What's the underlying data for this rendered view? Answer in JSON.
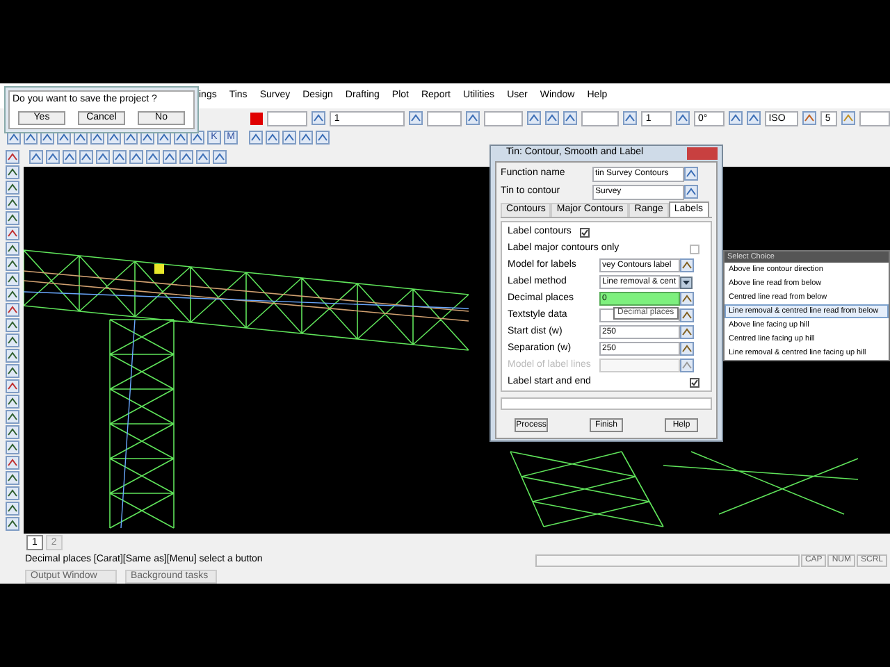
{
  "save_dialog": {
    "message": "Do you want to save the project ?",
    "buttons": [
      "Yes",
      "Cancel",
      "No"
    ]
  },
  "menu_bar": [
    "ings",
    "Tins",
    "Survey",
    "Design",
    "Drafting",
    "Plot",
    "Report",
    "Utilities",
    "User",
    "Window",
    "Help"
  ],
  "toolbar_fields": [
    {
      "value": "1"
    },
    {
      "value": "1"
    },
    {
      "value": "0°"
    },
    {
      "value": "ISO"
    },
    {
      "value": "5"
    }
  ],
  "toolbar_letters": [
    "K",
    "M"
  ],
  "tin_dialog": {
    "title": "Tin: Contour, Smooth and Label",
    "function_name": {
      "label": "Function name",
      "value": "tin Survey Contours"
    },
    "tin_to_contour": {
      "label": "Tin to contour",
      "value": "Survey"
    },
    "tabs": [
      {
        "label": "Contours",
        "selected": false
      },
      {
        "label": "Major Contours",
        "selected": false
      },
      {
        "label": "Range",
        "selected": false
      },
      {
        "label": "Labels",
        "selected": true
      }
    ],
    "rows": [
      {
        "kind": "checkbox_inline",
        "label": "Label contours",
        "checked": true
      },
      {
        "kind": "checkbox",
        "label": "Label major contours only",
        "checked": false
      },
      {
        "kind": "field",
        "label": "Model for labels",
        "value": "vey Contours label",
        "disabled": false,
        "active": false
      },
      {
        "kind": "dropdown",
        "label": "Label method",
        "value": "Line removal & cent"
      },
      {
        "kind": "field",
        "label": "Decimal places",
        "value": "0",
        "disabled": false,
        "active": true
      },
      {
        "kind": "field",
        "label": "Textstyle data",
        "value": "",
        "disabled": false,
        "active": false
      },
      {
        "kind": "field",
        "label": "Start dist (w)",
        "value": "250",
        "disabled": false,
        "active": false
      },
      {
        "kind": "field",
        "label": "Separation (w)",
        "value": "250",
        "disabled": false,
        "active": false
      },
      {
        "kind": "field",
        "label": "Model of label lines",
        "value": "",
        "disabled": true,
        "active": false
      },
      {
        "kind": "checkbox",
        "label": "Label start and end",
        "checked": true
      }
    ],
    "tooltip": "Decimal places",
    "buttons": [
      "Process",
      "Finish",
      "Help"
    ]
  },
  "select_choice": {
    "title": "Select Choice",
    "options": [
      {
        "label": "Above line contour direction",
        "selected": false
      },
      {
        "label": "Above line read from below",
        "selected": false
      },
      {
        "label": "Centred line read from below",
        "selected": false
      },
      {
        "label": "Line removal & centred line read from below",
        "selected": true
      },
      {
        "label": "Above line facing up hill",
        "selected": false
      },
      {
        "label": "Centred line facing up hill",
        "selected": false
      },
      {
        "label": "Line removal & centred line facing up hill",
        "selected": false
      }
    ]
  },
  "view_tabs": [
    {
      "label": "1",
      "selected": true
    },
    {
      "label": "2",
      "selected": false
    }
  ],
  "status_bar": {
    "message": "Decimal places [Carat][Same as][Menu] select a button",
    "indicators": [
      "CAP",
      "NUM",
      "SCRL"
    ]
  },
  "bottom_tabs": [
    "Output Window",
    "Background tasks"
  ]
}
